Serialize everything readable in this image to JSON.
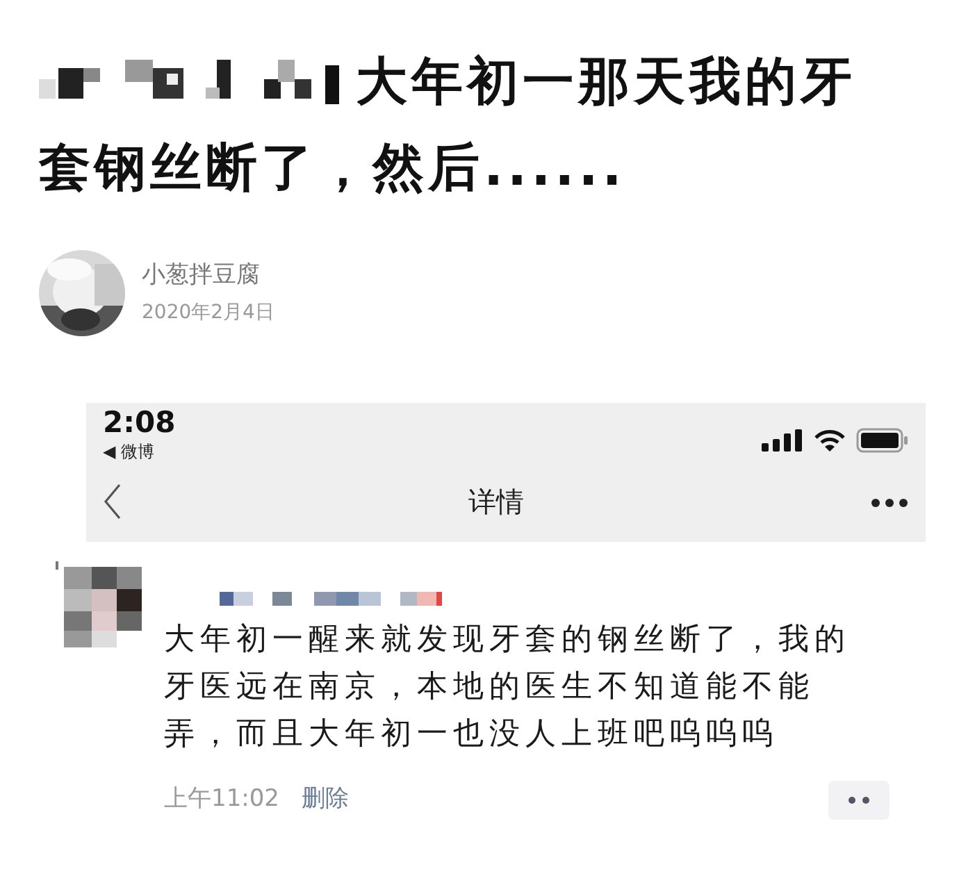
{
  "article": {
    "title_lines": [
      "大年初一那天我的牙",
      "套钢丝断了，然后......"
    ],
    "author": "小葱拌豆腐",
    "date": "2020年2月4日"
  },
  "phone": {
    "status_time": "2:08",
    "back_app": "◀ 微博",
    "nav_title": "详情",
    "comment": {
      "text": "大年初一醒来就发现牙套的钢丝断了，我的牙医远在南京，本地的医生不知道能不能弄，而且大年初一也没人上班吧呜呜呜",
      "time": "上午11:02",
      "action": "删除"
    }
  }
}
